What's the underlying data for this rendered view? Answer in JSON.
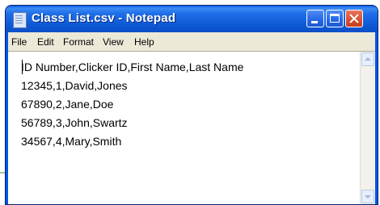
{
  "window": {
    "title": "Class List.csv - Notepad"
  },
  "menu": {
    "file": "File",
    "edit": "Edit",
    "format": "Format",
    "view": "View",
    "help": "Help"
  },
  "document": {
    "lines": [
      "ID Number,Clicker ID,First Name,Last Name",
      "12345,1,David,Jones",
      "67890,2,Jane,Doe",
      "56789,3,John,Swartz",
      "34567,4,Mary,Smith"
    ]
  },
  "icons": {
    "app": "notepad-icon",
    "minimize": "minimize-icon",
    "maximize": "maximize-icon",
    "close": "close-icon"
  },
  "colors": {
    "titlebar": "#0f5ad6",
    "close_button": "#d6502f",
    "menubar": "#ece9d8"
  }
}
